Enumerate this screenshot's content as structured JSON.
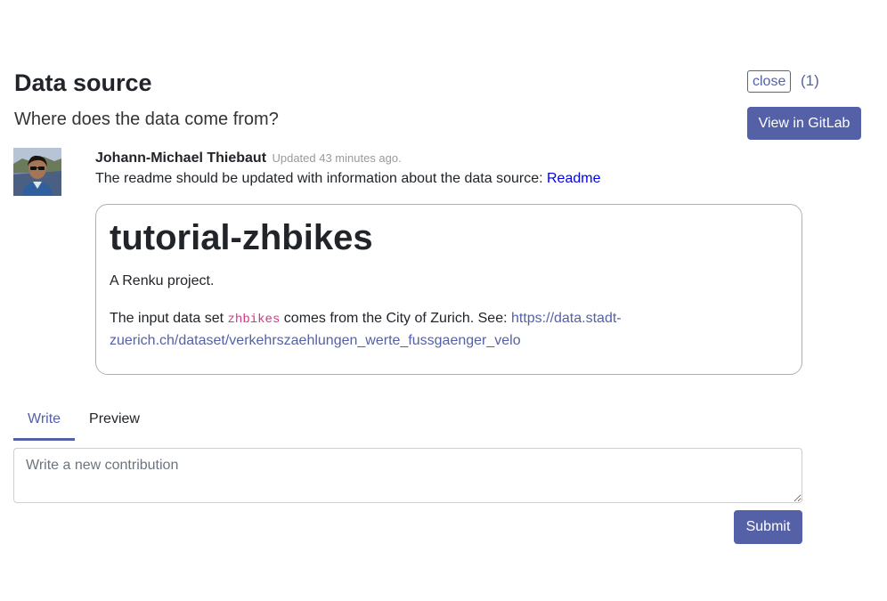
{
  "header": {
    "title": "Data source",
    "subtitle": "Where does the data come from?",
    "status_badge": "close",
    "contribution_count": "(1)",
    "gitlab_button": "View in GitLab"
  },
  "contribution": {
    "author": "Johann-Michael Thiebaut",
    "updated": "Updated 43 minutes ago.",
    "text": "The readme should be updated with information about the data source: ",
    "link": "Readme"
  },
  "readme": {
    "title": "tutorial-zhbikes",
    "description": "A Renku project.",
    "text_before": "The input data set ",
    "code": "zhbikes",
    "text_after": " comes from the City of Zurich. See: ",
    "link": "https://data.stadt-zuerich.ch/dataset/verkehrszaehlungen_werte_fussgaenger_velo"
  },
  "editor": {
    "tabs": [
      {
        "label": "Write"
      },
      {
        "label": "Preview"
      }
    ],
    "placeholder": "Write a new contribution",
    "submit": "Submit"
  },
  "colors": {
    "accent": "#5561a6",
    "link": "#0000ee",
    "code": "#d63384"
  }
}
